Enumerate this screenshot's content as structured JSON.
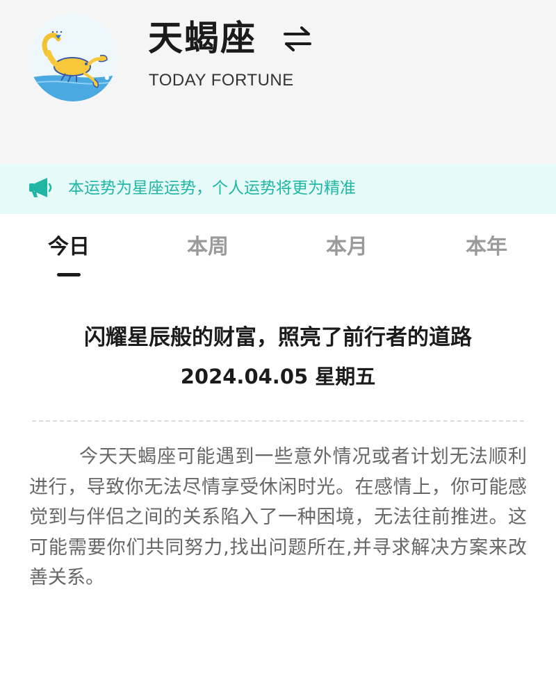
{
  "header": {
    "sign_name": "天蝎座",
    "subtitle": "TODAY FORTUNE",
    "avatar_icon": "scorpion-icon",
    "switch_icon": "swap-arrows-icon"
  },
  "notice": {
    "icon": "megaphone-icon",
    "text": "本运势为星座运势，个人运势将更为精准",
    "color": "#1fb6a6",
    "background": "#e6faf8"
  },
  "tabs": [
    {
      "label": "今日",
      "active": true
    },
    {
      "label": "本周",
      "active": false
    },
    {
      "label": "本月",
      "active": false
    },
    {
      "label": "本年",
      "active": false
    }
  ],
  "fortune": {
    "headline": "闪耀星辰般的财富，照亮了前行者的道路",
    "date": "2024.04.05 星期五",
    "body": "今天天蝎座可能遇到一些意外情况或者计划无法顺利进行，导致你无法尽情享受休闲时光。在感情上，你可能感觉到与伴侣之间的关系陷入了一种困境，无法往前推进。这可能需要你们共同努力,找出问题所在,并寻求解决方案来改善关系。"
  }
}
